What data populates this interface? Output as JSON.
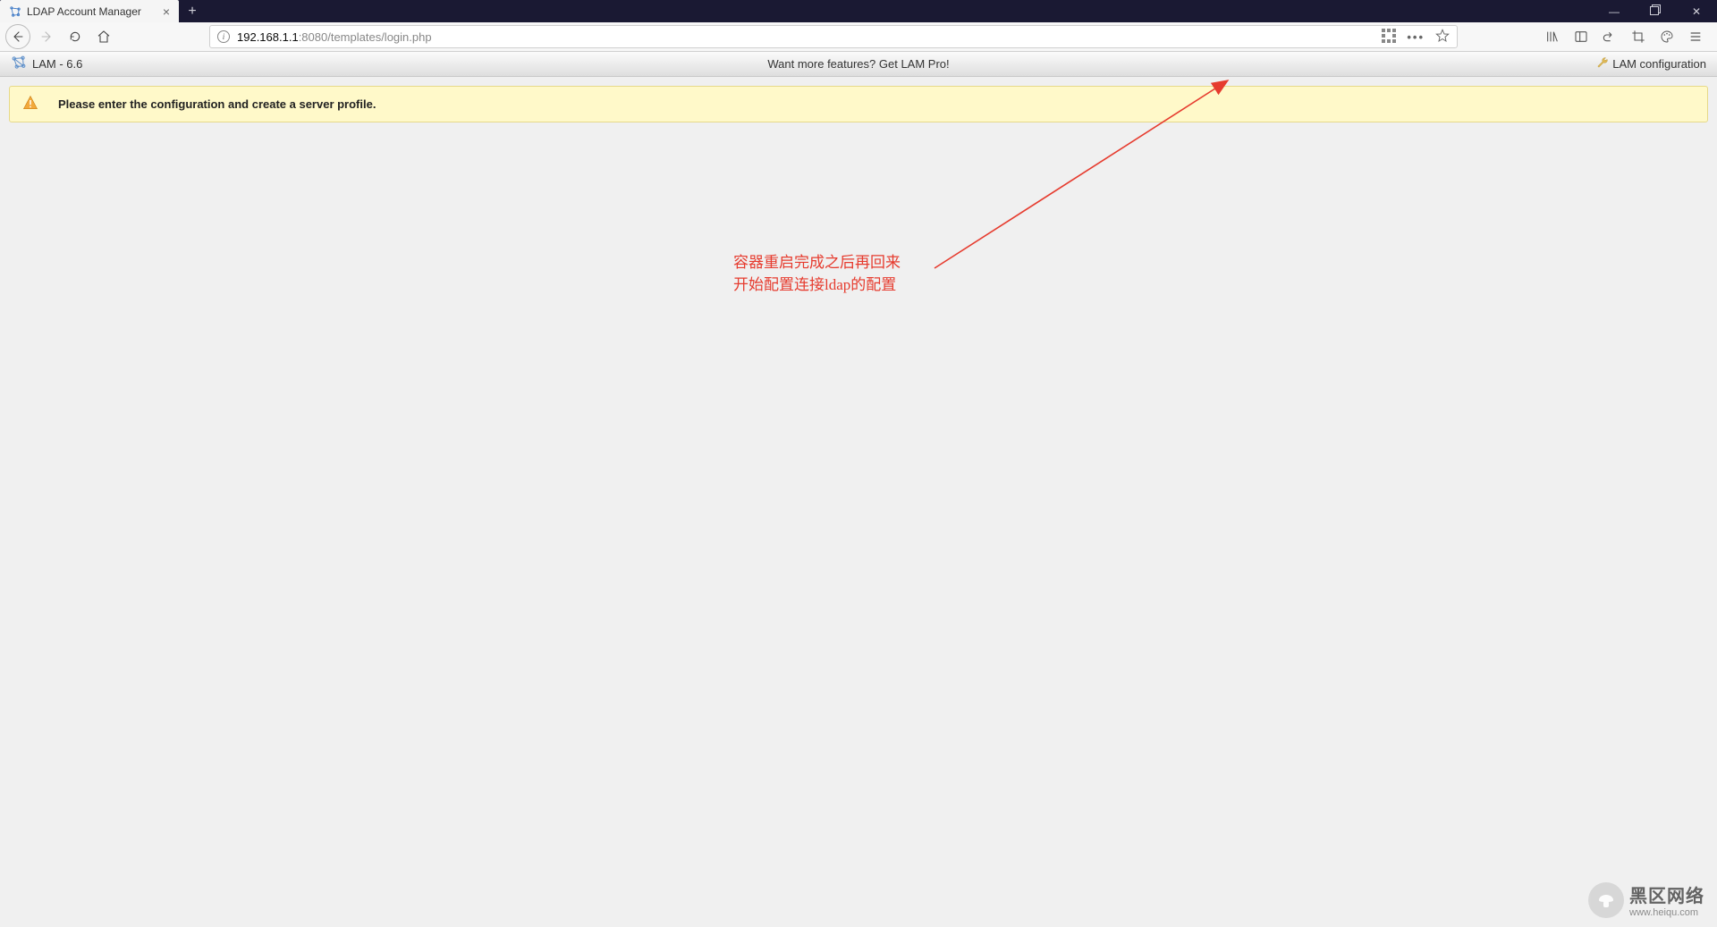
{
  "browser": {
    "tab_title": "LDAP Account Manager",
    "url_prefix": "192.168.1.1",
    "url_suffix": ":8080/templates/login.php"
  },
  "lam": {
    "version_label": "LAM - 6.6",
    "pro_link_text": "Want more features? Get LAM Pro!",
    "config_link_text": "LAM configuration",
    "message": "Please enter the configuration and create a server profile."
  },
  "annotation": {
    "line1": "容器重启完成之后再回来",
    "line2": "开始配置连接ldap的配置"
  },
  "watermark": {
    "line1": "黑区网络",
    "line2": "www.heiqu.com"
  }
}
